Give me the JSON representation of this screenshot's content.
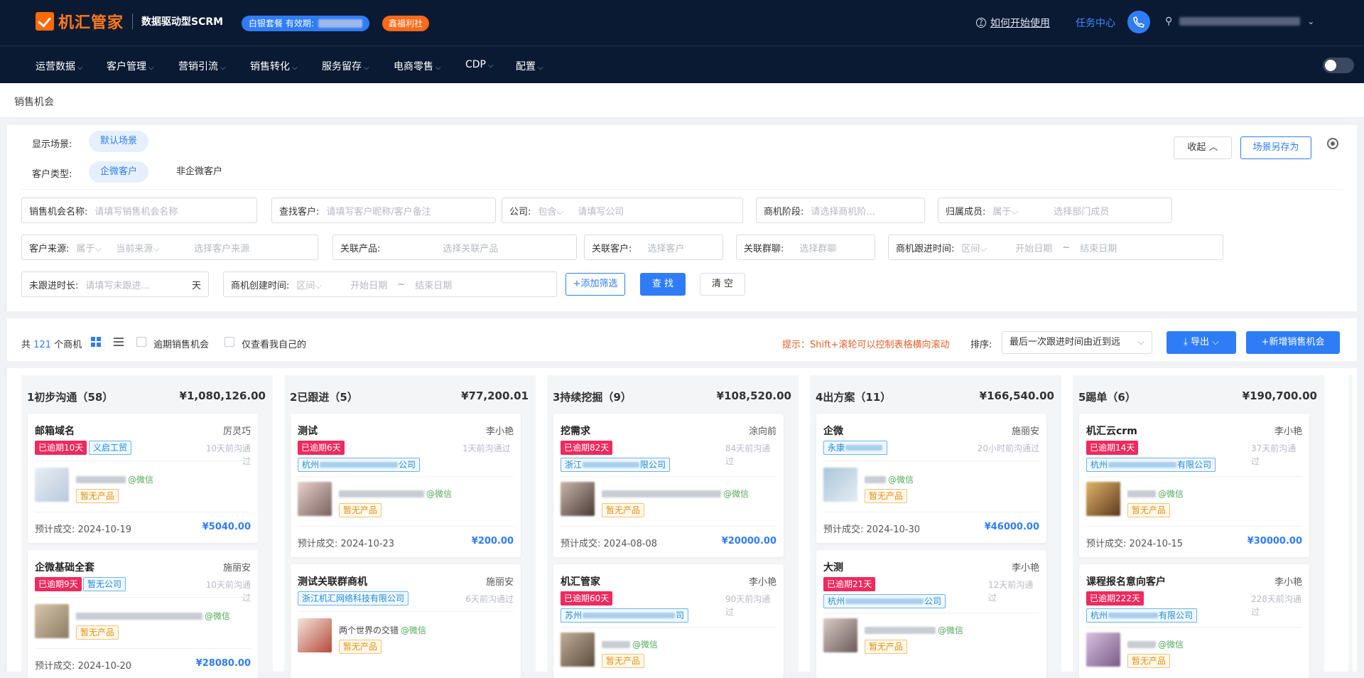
{
  "header": {
    "brand": "机汇管家",
    "subtitle": "数据驱动型SCRM",
    "plan_label": "白银套餐 有效期:",
    "welfare": "鑫福利社",
    "help": "如何开始使用",
    "task_center": "任务中心"
  },
  "nav": [
    "运营数据",
    "客户管理",
    "营销引流",
    "销售转化",
    "服务留存",
    "电商零售",
    "CDP",
    "配置"
  ],
  "breadcrumb": "销售机会",
  "filters": {
    "scene_label": "显示场景:",
    "scene_default": "默认场景",
    "type_label": "客户类型:",
    "type_options": [
      "企微客户",
      "非企微客户"
    ],
    "collapse": "收起",
    "save_scene": "场景另存为",
    "fields": {
      "opp_name": {
        "label": "销售机会名称:",
        "placeholder": "请填写销售机会名称"
      },
      "find_customer": {
        "label": "查找客户:",
        "placeholder": "请填写客户昵称/客户备注"
      },
      "company": {
        "label": "公司:",
        "select": "包含",
        "placeholder": "请填写公司"
      },
      "stage": {
        "label": "商机阶段:",
        "placeholder": "请选择商机阶..."
      },
      "owner": {
        "label": "归属成员:",
        "select": "属于",
        "placeholder": "选择部门成员"
      },
      "source": {
        "label": "客户来源:",
        "select": "属于",
        "select2": "当前来源",
        "placeholder": "选择客户来源"
      },
      "product": {
        "label": "关联产品:",
        "placeholder": "选择关联产品"
      },
      "rel_customer": {
        "label": "关联客户:",
        "placeholder": "选择客户"
      },
      "group": {
        "label": "关联群聊:",
        "placeholder": "选择群聊"
      },
      "follow_time": {
        "label": "商机跟进时间:",
        "select": "区间",
        "start": "开始日期",
        "end": "结束日期"
      },
      "idle": {
        "label": "未跟进时长:",
        "placeholder": "请填写未跟进...",
        "suffix": "天"
      },
      "created": {
        "label": "商机创建时间:",
        "select": "区间",
        "start": "开始日期",
        "end": "结束日期"
      }
    },
    "tilde": "~",
    "add_filter": "添加筛选",
    "search": "查 找",
    "clear": "清 空"
  },
  "toolbar": {
    "total_prefix": "共",
    "total": "121",
    "total_suffix": "个商机",
    "overdue": "逾期销售机会",
    "mine": "仅查看我自己的",
    "hint": "提示：Shift+滚轮可以控制表格横向滚动",
    "sort_label": "排序:",
    "sort_value": "最后一次跟进时间由近到远",
    "export": "导出",
    "new": "新增销售机会"
  },
  "columns": [
    {
      "title": "1初步沟通（58）",
      "sum": "¥1,080,126.00",
      "cards": [
        {
          "name": "邮箱域名",
          "owner": "厉灵巧",
          "overdue": "已逾期10天",
          "tag": "义启工贸",
          "ago": "10天前沟通过",
          "contact": "@微信",
          "product": "暂无产品",
          "est": "预计成交:",
          "date": "2024-10-19",
          "amount": "¥5040.00"
        },
        {
          "name": "企微基础全套",
          "owner": "施丽安",
          "overdue": "已逾期9天",
          "tag": "暂无公司",
          "ago": "10天前沟通过",
          "contact": "@微信",
          "product": "暂无产品",
          "est": "预计成交:",
          "date": "2024-10-20",
          "amount": "¥28080.00"
        }
      ]
    },
    {
      "title": "2已跟进（5）",
      "sum": "¥77,200.01",
      "cards": [
        {
          "name": "测试",
          "owner": "李小艳",
          "overdue": "已逾期6天",
          "tag_prefix": "杭州",
          "tag_suffix": "公司",
          "ago": "1天前沟通过",
          "contact": "@微信",
          "product": "暂无产品",
          "est": "预计成交:",
          "date": "2024-10-23",
          "amount": "¥200.00"
        },
        {
          "name": "测试关联群商机",
          "owner": "施丽安",
          "tag": "浙江机汇网络科技有限公司",
          "ago": "6天前沟通过",
          "contact_name": "两个世界の交错",
          "contact": "@微信",
          "product": "暂无产品"
        }
      ]
    },
    {
      "title": "3持续挖掘（9）",
      "sum": "¥108,520.00",
      "cards": [
        {
          "name": "挖需求",
          "owner": "涂向前",
          "overdue": "已逾期82天",
          "tag_prefix": "浙江",
          "tag_suffix": "限公司",
          "ago": "84天前沟通过",
          "contact": "@微信",
          "product": "暂无产品",
          "est": "预计成交:",
          "date": "2024-08-08",
          "amount": "¥20000.00"
        },
        {
          "name": "机汇管家",
          "owner": "李小艳",
          "overdue": "已逾期60天",
          "tag_prefix": "苏州",
          "tag_suffix": "司",
          "ago": "90天前沟通过",
          "contact": "@微信",
          "product": "暂无产品"
        }
      ]
    },
    {
      "title": "4出方案（11）",
      "sum": "¥166,540.00",
      "cards": [
        {
          "name": "企微",
          "owner": "施丽安",
          "tag_prefix": "永康",
          "tag_suffix": "",
          "ago": "20小时前沟通过",
          "contact": "@微信",
          "product": "暂无产品",
          "est": "预计成交:",
          "date": "2024-10-30",
          "amount": "¥46000.00"
        },
        {
          "name": "大测",
          "owner": "李小艳",
          "overdue": "已逾期21天",
          "tag_prefix": "杭州",
          "tag_suffix": "公司",
          "ago": "12天前沟通过",
          "contact": "@微信",
          "product": "暂无产品"
        }
      ]
    },
    {
      "title": "5踢单（6）",
      "sum": "¥190,700.00",
      "cards": [
        {
          "name": "机汇云crm",
          "owner": "李小艳",
          "overdue": "已逾期14天",
          "tag_prefix": "杭州",
          "tag_suffix": "有限公司",
          "ago": "37天前沟通过",
          "contact": "@微信",
          "product": "暂无产品",
          "est": "预计成交:",
          "date": "2024-10-15",
          "amount": "¥30000.00"
        },
        {
          "name": "课程报名意向客户",
          "owner": "李小艳",
          "overdue": "已逾期222天",
          "tag_prefix": "杭州",
          "tag_suffix": "有限公司",
          "ago": "228天前沟通过",
          "contact": "@微信",
          "product": "暂无产品"
        }
      ]
    }
  ],
  "colors": {
    "primary": "#2f7df6",
    "overdue": "#ee2a5e",
    "header_bg": "#0b1a33",
    "brand": "#ff6a00",
    "hint": "#e0612a"
  }
}
